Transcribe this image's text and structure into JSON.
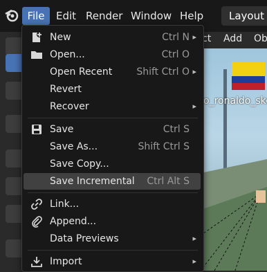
{
  "menubar": {
    "items": [
      "File",
      "Edit",
      "Render",
      "Window",
      "Help"
    ],
    "workspace_tab": "Layout"
  },
  "viewport_header": {
    "items": [
      "ct",
      "Add",
      "Ob"
    ]
  },
  "viewport": {
    "object_label": "o_ronaldo_ske"
  },
  "file_menu": {
    "items": [
      {
        "label": "New",
        "shortcut": "Ctrl N",
        "submenu": true,
        "icon": "new-file-icon"
      },
      {
        "label": "Open...",
        "shortcut": "Ctrl O",
        "submenu": false,
        "icon": "folder-icon"
      },
      {
        "label": "Open Recent",
        "shortcut": "Shift Ctrl O",
        "submenu": true,
        "icon": ""
      },
      {
        "label": "Revert",
        "shortcut": "",
        "submenu": false,
        "icon": ""
      },
      {
        "label": "Recover",
        "shortcut": "",
        "submenu": true,
        "icon": ""
      },
      {
        "label": "Save",
        "shortcut": "Ctrl S",
        "submenu": false,
        "icon": "save-icon"
      },
      {
        "label": "Save As...",
        "shortcut": "Shift Ctrl S",
        "submenu": false,
        "icon": ""
      },
      {
        "label": "Save Copy...",
        "shortcut": "",
        "submenu": false,
        "icon": ""
      },
      {
        "label": "Save Incremental",
        "shortcut": "Ctrl Alt S",
        "submenu": false,
        "icon": "",
        "highlighted": true
      },
      {
        "label": "Link...",
        "shortcut": "",
        "submenu": false,
        "icon": "link-icon"
      },
      {
        "label": "Append...",
        "shortcut": "",
        "submenu": false,
        "icon": "paperclip-icon"
      },
      {
        "label": "Data Previews",
        "shortcut": "",
        "submenu": true,
        "icon": ""
      },
      {
        "label": "Import",
        "shortcut": "",
        "submenu": true,
        "icon": "import-icon"
      }
    ]
  }
}
